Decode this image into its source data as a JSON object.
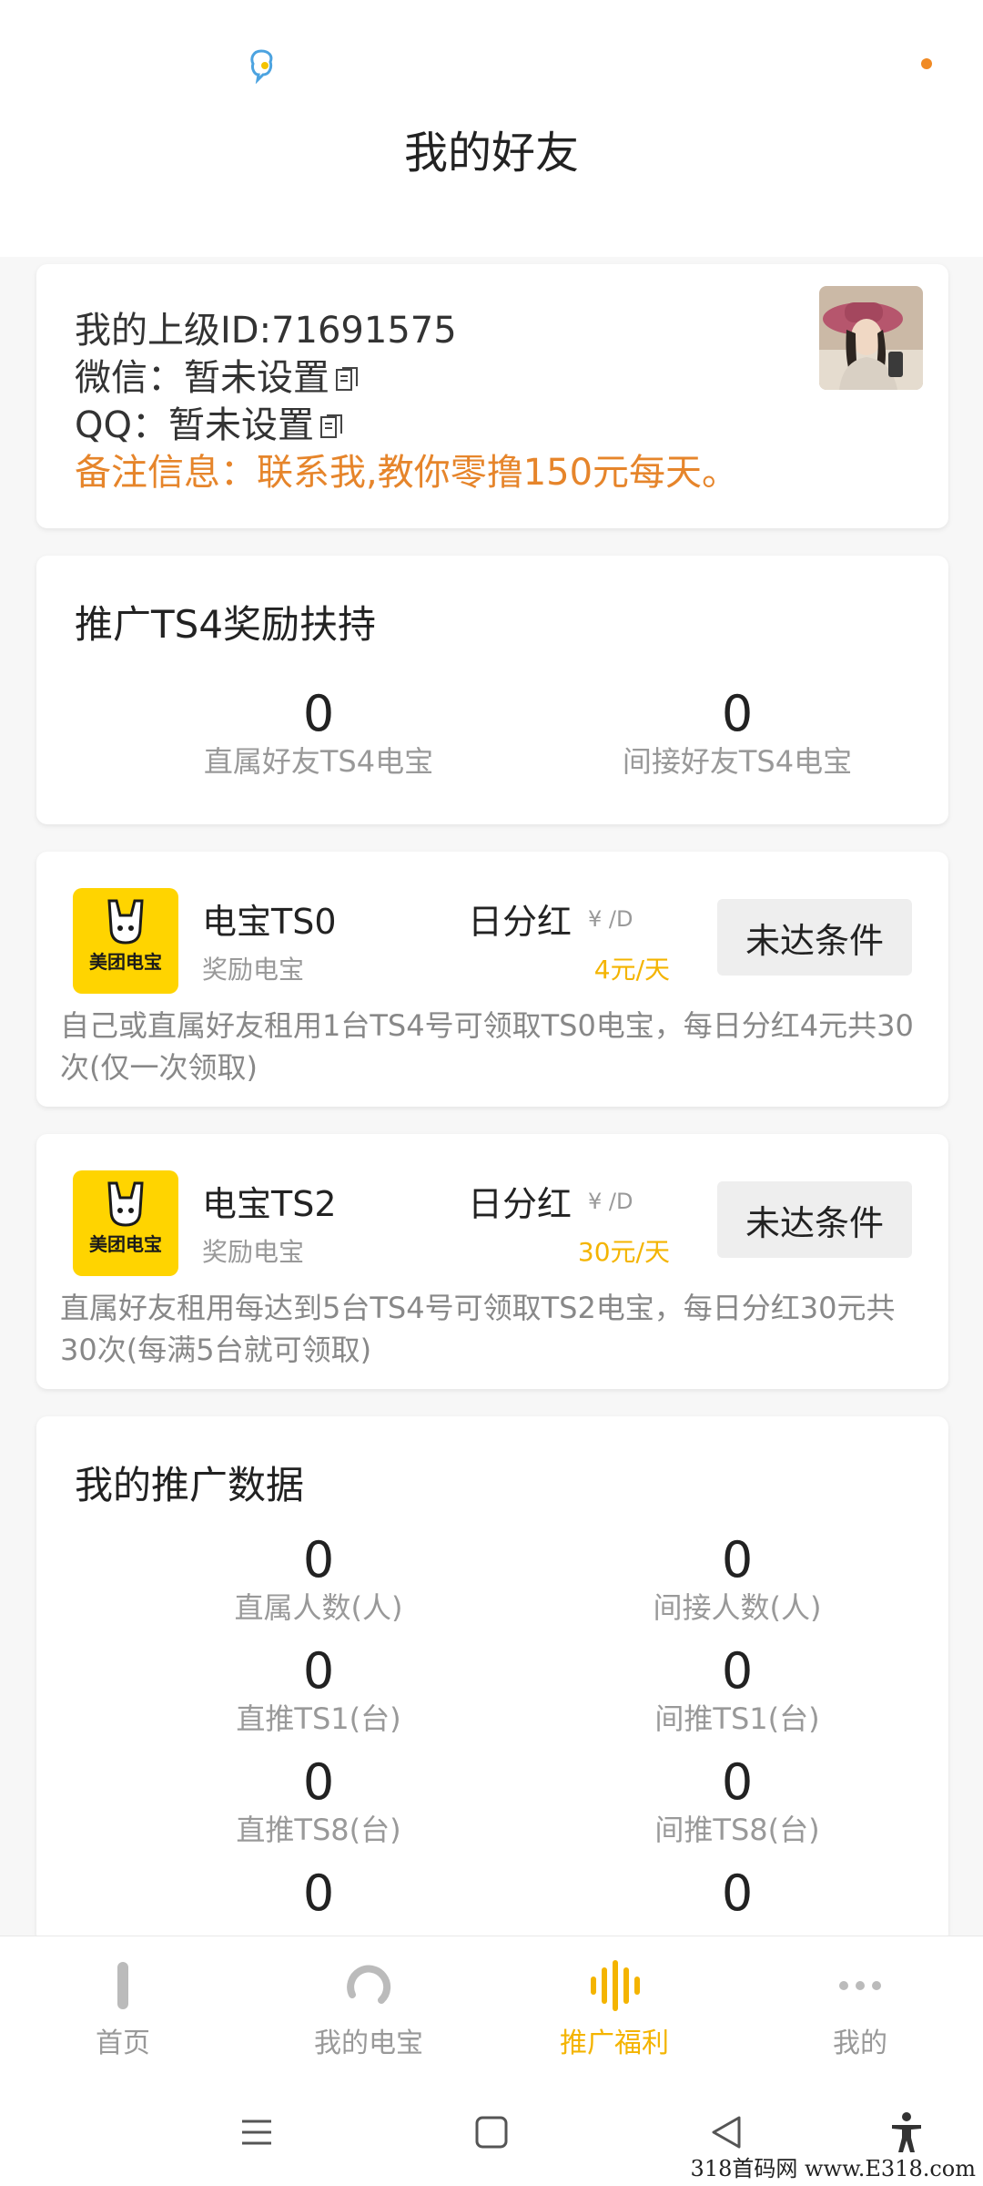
{
  "header": {
    "title": "我的好友"
  },
  "upline": {
    "id_line": "我的上级ID:71691575",
    "wechat_line": "微信：暂未设置",
    "qq_line": "QQ：暂未设置",
    "note_line": "备注信息：联系我,教你零撸150元每天。"
  },
  "ts4_support": {
    "title": "推广TS4奖励扶持",
    "stats": [
      {
        "value": "0",
        "label": "直属好友TS4电宝"
      },
      {
        "value": "0",
        "label": "间接好友TS4电宝"
      }
    ]
  },
  "rewards": [
    {
      "logo_text": "美团电宝",
      "name": "电宝TS0",
      "sub": "奖励电宝",
      "dividend_label": "日分红",
      "unit": "¥ /D",
      "amount": "4元/天",
      "button": "未达条件",
      "description": "自己或直属好友租用1台TS4号可领取TS0电宝，每日分红4元共30次(仅一次领取)"
    },
    {
      "logo_text": "美团电宝",
      "name": "电宝TS2",
      "sub": "奖励电宝",
      "dividend_label": "日分红",
      "unit": "¥ /D",
      "amount": "30元/天",
      "button": "未达条件",
      "description": "直属好友租用每达到5台TS4号可领取TS2电宝，每日分红30元共30次(每满5台就可领取)"
    }
  ],
  "promo_data": {
    "title": "我的推广数据",
    "stats": [
      {
        "value": "0",
        "label": "直属人数(人)"
      },
      {
        "value": "0",
        "label": "间接人数(人)"
      },
      {
        "value": "0",
        "label": "直推TS1(台)"
      },
      {
        "value": "0",
        "label": "间推TS1(台)"
      },
      {
        "value": "0",
        "label": "直推TS8(台)"
      },
      {
        "value": "0",
        "label": "间推TS8(台)"
      },
      {
        "value": "0",
        "label": ""
      },
      {
        "value": "0",
        "label": ""
      }
    ]
  },
  "nav": [
    {
      "label": "首页",
      "icon": "bar-icon"
    },
    {
      "label": "我的电宝",
      "icon": "refresh-icon"
    },
    {
      "label": "推广福利",
      "icon": "wave-icon",
      "active": true
    },
    {
      "label": "我的",
      "icon": "more-icon"
    }
  ],
  "watermark": "318首码网 www.E318.com",
  "colors": {
    "accent": "#f4b400",
    "note": "#e6852b",
    "brand_yellow": "#ffd400"
  }
}
